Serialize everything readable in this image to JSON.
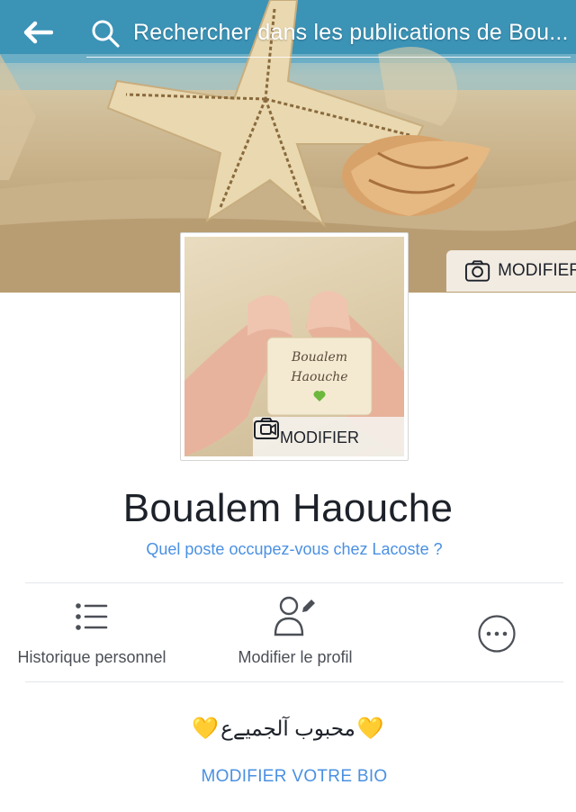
{
  "search": {
    "placeholder": "Rechercher dans les publications de Bou..."
  },
  "cover": {
    "edit_label": "MODIFIER"
  },
  "profile_picture": {
    "edit_label": "MODIFIER",
    "card_line1": "Boualem",
    "card_line2": "Haouche"
  },
  "profile": {
    "name": "Boualem Haouche",
    "job_prompt": "Quel poste occupez-vous chez Lacoste ?"
  },
  "actions": [
    {
      "label": "Historique personnel",
      "icon": "list-icon"
    },
    {
      "label": "Modifier le profil",
      "icon": "edit-profile-icon"
    },
    {
      "label": "",
      "icon": "more-icon"
    }
  ],
  "bio": {
    "text": "محبوب آلجميےع",
    "heart": "💛",
    "edit_label": "MODIFIER VOTRE BIO"
  },
  "colors": {
    "link": "#4a90e2",
    "heart": "#f5b400",
    "text": "#1d2129"
  }
}
